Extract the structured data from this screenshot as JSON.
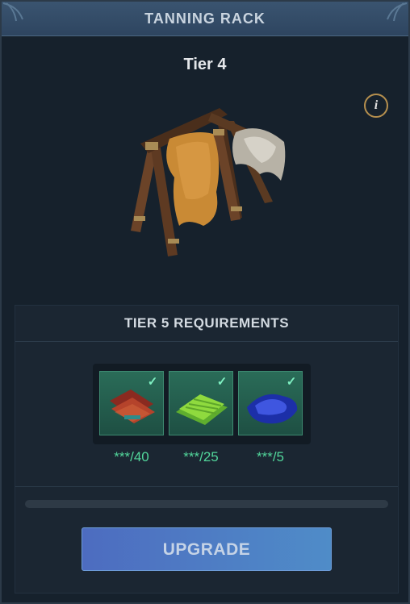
{
  "header": {
    "title": "TANNING RACK"
  },
  "building": {
    "tier_label": "Tier 4",
    "info_icon": "i"
  },
  "requirements": {
    "title": "TIER 5 REQUIREMENTS",
    "items": [
      {
        "icon": "red-leather-icon",
        "count": "***/40",
        "checked": true
      },
      {
        "icon": "green-leather-icon",
        "count": "***/25",
        "checked": true
      },
      {
        "icon": "blue-leather-icon",
        "count": "***/5",
        "checked": true
      }
    ],
    "progress": 0
  },
  "upgrade": {
    "label": "UPGRADE"
  },
  "colors": {
    "header": "#34506b",
    "panel": "#16212c",
    "accent_green": "#52d69b",
    "button": "#4f7bc4"
  }
}
